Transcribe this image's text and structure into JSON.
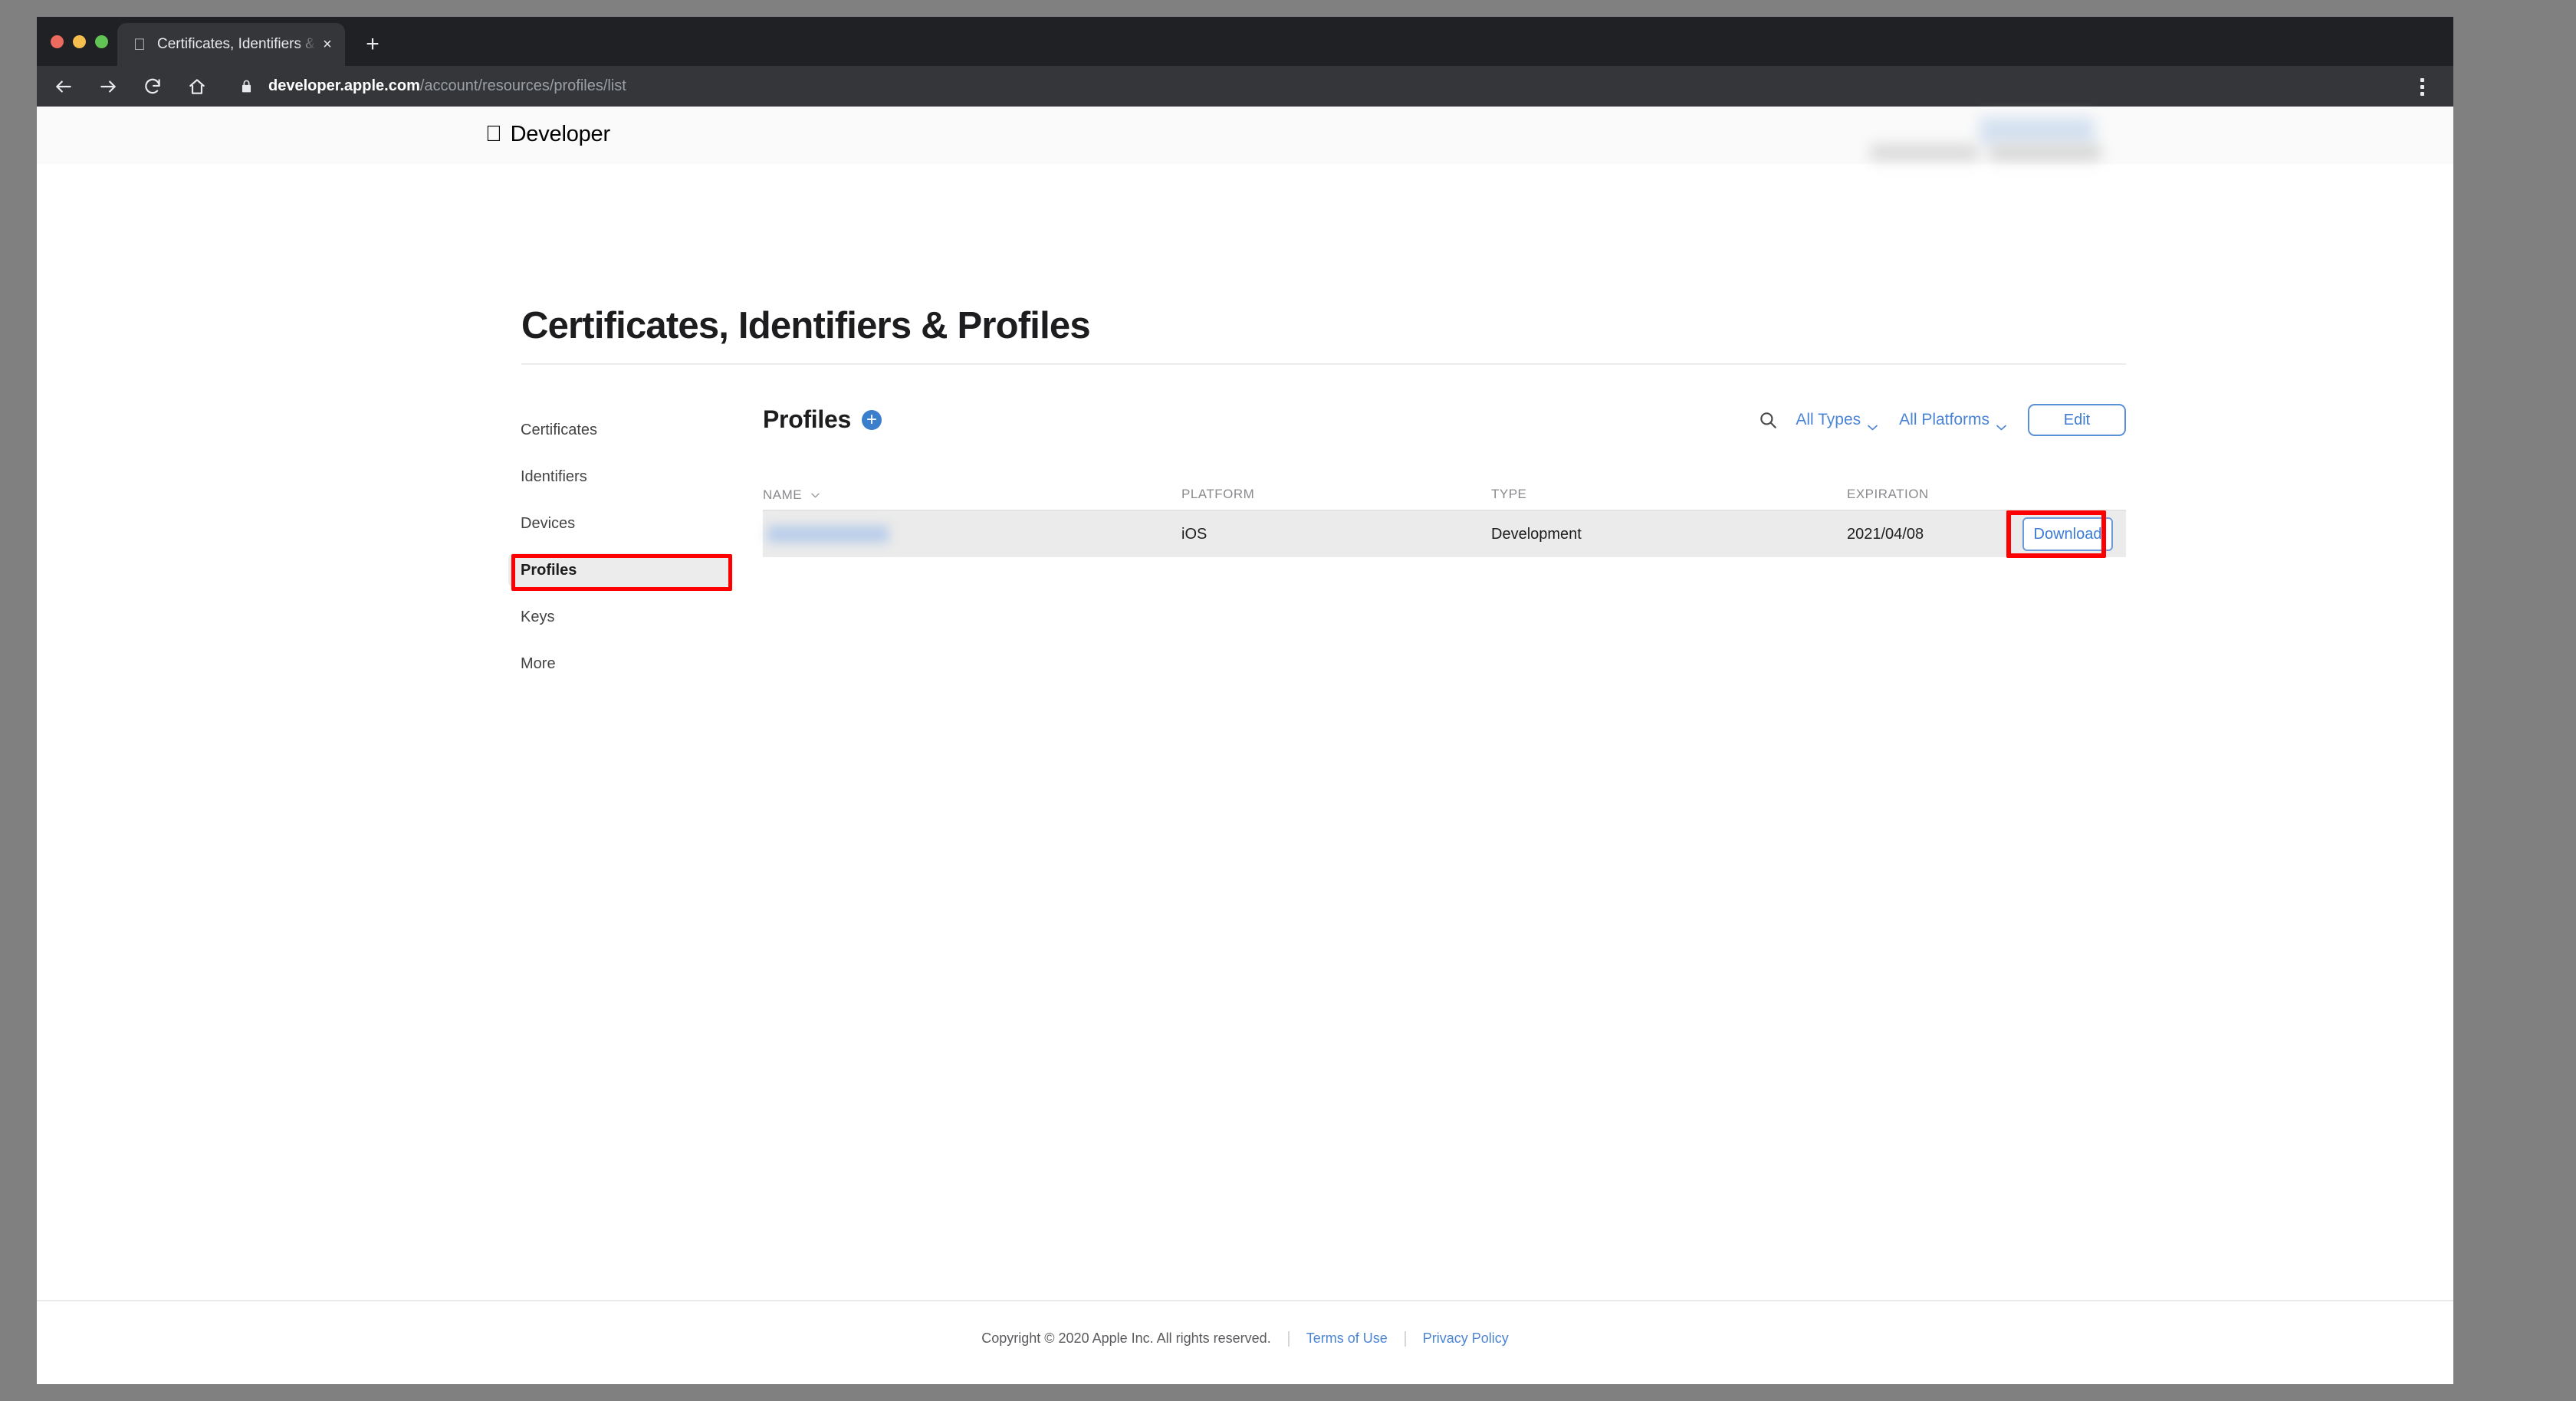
{
  "browser": {
    "tab": {
      "title": "Certificates, Identifiers & Profiles",
      "favicon": "apple-icon",
      "close_label": "×"
    },
    "new_tab_label": "+",
    "nav": {
      "back": "back-arrow-icon",
      "forward": "forward-arrow-icon",
      "reload": "reload-icon",
      "home": "home-icon"
    },
    "address": {
      "lock": "lock-icon",
      "host": "developer.apple.com",
      "path": "/account/resources/profiles/list",
      "full_url": "developer.apple.com/account/resources/profiles/list"
    },
    "menu_label": "browser-menu-icon"
  },
  "site_header": {
    "apple_glyph": "",
    "brand": "Developer",
    "account_redacted": true
  },
  "page": {
    "title": "Certificates, Identifiers & Profiles"
  },
  "sidebar": {
    "items": [
      {
        "label": "Certificates",
        "selected": false
      },
      {
        "label": "Identifiers",
        "selected": false
      },
      {
        "label": "Devices",
        "selected": false
      },
      {
        "label": "Profiles",
        "selected": true
      },
      {
        "label": "Keys",
        "selected": false
      },
      {
        "label": "More",
        "selected": false
      }
    ]
  },
  "main": {
    "heading": "Profiles",
    "add_button_label": "+",
    "search_icon": "search-icon",
    "filters": [
      {
        "label": "All Types"
      },
      {
        "label": "All Platforms"
      }
    ],
    "edit_label": "Edit"
  },
  "table": {
    "columns": [
      {
        "key": "name",
        "label": "NAME",
        "sortable": true
      },
      {
        "key": "platform",
        "label": "PLATFORM",
        "sortable": false
      },
      {
        "key": "type",
        "label": "TYPE",
        "sortable": false
      },
      {
        "key": "expiration",
        "label": "EXPIRATION",
        "sortable": false
      },
      {
        "key": "action",
        "label": "",
        "sortable": false
      }
    ],
    "rows": [
      {
        "name": "",
        "name_redacted": true,
        "platform": "iOS",
        "type": "Development",
        "expiration": "2021/04/08",
        "action_label": "Download"
      }
    ]
  },
  "annotations": {
    "highlight_color": "#fe0000",
    "boxes": [
      {
        "target": "sidebar-item-profiles"
      },
      {
        "target": "download-button"
      }
    ]
  },
  "footer": {
    "copyright": "Copyright © 2020 Apple Inc. All rights reserved.",
    "links": [
      {
        "label": "Terms of Use"
      },
      {
        "label": "Privacy Policy"
      }
    ]
  },
  "colors": {
    "accent_blue": "#4a84d6",
    "add_button_blue": "#3b7ecc",
    "row_background": "#ebebeb",
    "chrome_dark": "#202124",
    "toolbar_dark": "#35363a",
    "traffic_red": "#ed6a5e",
    "traffic_yellow": "#f5bf4f",
    "traffic_green": "#61c454"
  }
}
